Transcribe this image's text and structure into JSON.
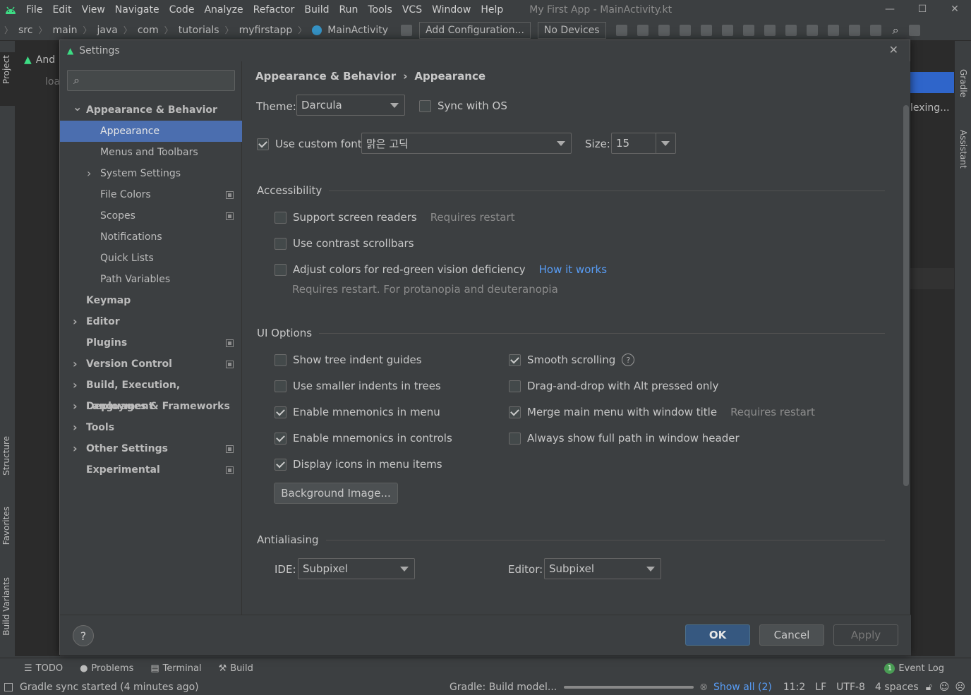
{
  "ide": {
    "menu": [
      "File",
      "Edit",
      "View",
      "Navigate",
      "Code",
      "Analyze",
      "Refactor",
      "Build",
      "Run",
      "Tools",
      "VCS",
      "Window",
      "Help"
    ],
    "window_title": "My First App - MainActivity.kt",
    "breadcrumbs": [
      "src",
      "main",
      "java",
      "com",
      "tutorials",
      "myfirstapp",
      "MainActivity"
    ],
    "add_configuration": "Add Configuration...",
    "no_devices": "No Devices",
    "project_tab": "Project",
    "project_header": "And",
    "project_loading": "loa",
    "editor_snippet": "lexing...",
    "structure_tab": "Structure",
    "favorites_tab": "Favorites",
    "build_variants_tab": "Build Variants",
    "gradle_tab": "Gradle",
    "assistant_tab": "Assistant",
    "bottom_tabs": [
      "TODO",
      "Problems",
      "Terminal",
      "Build"
    ],
    "event_log": "Event Log",
    "event_log_count": "1",
    "status_left": "Gradle sync started (4 minutes ago)",
    "status_gradle": "Gradle: Build model...",
    "status_show_all": "Show all (2)",
    "status_pos": "11:2",
    "status_lf": "LF",
    "status_enc": "UTF-8",
    "status_indent": "4 spaces"
  },
  "dialog": {
    "title": "Settings",
    "search_placeholder": "",
    "tree": [
      {
        "label": "Appearance & Behavior",
        "level": 0,
        "bold": true,
        "arrow": "down"
      },
      {
        "label": "Appearance",
        "level": 1,
        "selected": true
      },
      {
        "label": "Menus and Toolbars",
        "level": 1
      },
      {
        "label": "System Settings",
        "level": 1,
        "arrow": "right"
      },
      {
        "label": "File Colors",
        "level": 1,
        "copy": true
      },
      {
        "label": "Scopes",
        "level": 1,
        "copy": true
      },
      {
        "label": "Notifications",
        "level": 1
      },
      {
        "label": "Quick Lists",
        "level": 1
      },
      {
        "label": "Path Variables",
        "level": 1
      },
      {
        "label": "Keymap",
        "level": 0,
        "bold": true
      },
      {
        "label": "Editor",
        "level": 0,
        "bold": true,
        "arrow": "right"
      },
      {
        "label": "Plugins",
        "level": 0,
        "bold": true,
        "copy": true
      },
      {
        "label": "Version Control",
        "level": 0,
        "bold": true,
        "arrow": "right",
        "copy": true
      },
      {
        "label": "Build, Execution, Deployment",
        "level": 0,
        "bold": true,
        "arrow": "right"
      },
      {
        "label": "Languages & Frameworks",
        "level": 0,
        "bold": true,
        "arrow": "right"
      },
      {
        "label": "Tools",
        "level": 0,
        "bold": true,
        "arrow": "right"
      },
      {
        "label": "Other Settings",
        "level": 0,
        "bold": true,
        "arrow": "right",
        "copy": true
      },
      {
        "label": "Experimental",
        "level": 0,
        "bold": true,
        "copy": true
      }
    ],
    "breadcrumb": {
      "parent": "Appearance & Behavior",
      "sep": "›",
      "current": "Appearance"
    },
    "theme_label": "Theme:",
    "theme_value": "Darcula",
    "sync_os": "Sync with OS",
    "custom_font_label": "Use custom font:",
    "custom_font_value": "맑은 고딕",
    "size_label": "Size:",
    "size_value": "15",
    "accessibility": {
      "title": "Accessibility",
      "screen_readers": "Support screen readers",
      "requires_restart": "Requires restart",
      "contrast_scrollbars": "Use contrast scrollbars",
      "red_green": "Adjust colors for red-green vision deficiency",
      "how_it_works": "How it works",
      "red_green_note": "Requires restart. For protanopia and deuteranopia"
    },
    "ui_options": {
      "title": "UI Options",
      "tree_indent": "Show tree indent guides",
      "smaller_indents": "Use smaller indents in trees",
      "mnemonics_menu": "Enable mnemonics in menu",
      "mnemonics_controls": "Enable mnemonics in controls",
      "icons_menu": "Display icons in menu items",
      "smooth_scrolling": "Smooth scrolling",
      "drag_drop": "Drag-and-drop with Alt pressed only",
      "merge_menu": "Merge main menu with window title",
      "merge_note": "Requires restart",
      "full_path": "Always show full path in window header",
      "background_image": "Background Image..."
    },
    "antialiasing": {
      "title": "Antialiasing",
      "ide_label": "IDE:",
      "ide_value": "Subpixel",
      "editor_label": "Editor:",
      "editor_value": "Subpixel"
    },
    "ok": "OK",
    "cancel": "Cancel",
    "apply": "Apply",
    "help": "?"
  }
}
